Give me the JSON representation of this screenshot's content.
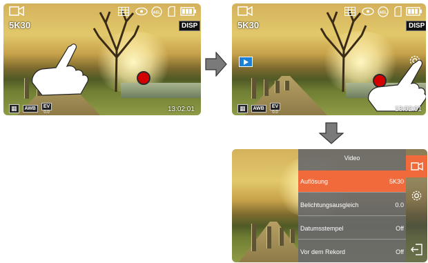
{
  "screen1": {
    "resolution": "5K30",
    "disp": "DISP",
    "time": "13:02:01",
    "awb": "AWB",
    "ev": "EV",
    "ev_val": "0.0"
  },
  "screen2": {
    "resolution": "5K30",
    "disp": "DISP",
    "time": "13:02:01",
    "awb": "AWB",
    "ev": "EV",
    "ev_val": "0.0"
  },
  "menu": {
    "title": "Video",
    "items": [
      {
        "label": "Auflösung",
        "value": "5K30"
      },
      {
        "label": "Belichtungsausgleich",
        "value": "0.0"
      },
      {
        "label": "Datumsstempel",
        "value": "Off"
      },
      {
        "label": "Vor dem Rekord",
        "value": "Off"
      }
    ]
  },
  "colors": {
    "accent": "#f06a3b",
    "rec": "#d40000",
    "arrow": "#7a7a7a"
  },
  "icons": [
    "video-camera-icon",
    "grid-icon",
    "ael-icon",
    "sd-card-icon",
    "battery-icon",
    "play-icon",
    "gear-icon",
    "exit-icon",
    "hand-pointer-icon"
  ]
}
